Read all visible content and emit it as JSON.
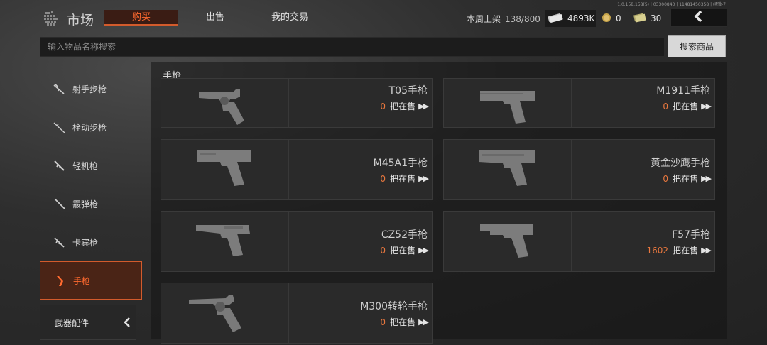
{
  "version": "1.0.158.158(5) | 03300843 | 11481450358 | 经验-7",
  "header": {
    "title": "市场",
    "tabs": [
      {
        "label": "购买",
        "active": true
      },
      {
        "label": "出售",
        "active": false
      },
      {
        "label": "我的交易",
        "active": false
      }
    ],
    "weekly_listing_label": "本周上架",
    "weekly_listing_value": "138/800",
    "currencies": [
      {
        "icon": "cash-stack-icon",
        "value": "4893K"
      },
      {
        "icon": "gold-coin-icon",
        "value": "0"
      },
      {
        "icon": "ticket-icon",
        "value": "30"
      }
    ]
  },
  "search": {
    "placeholder": "输入物品名称搜索",
    "button_label": "搜索商品"
  },
  "sidebar": {
    "items": [
      {
        "label": "射手步枪",
        "icon": "rifle-icon",
        "active": false
      },
      {
        "label": "栓动步枪",
        "icon": "sniper-rifle-icon",
        "active": false
      },
      {
        "label": "轻机枪",
        "icon": "machine-gun-icon",
        "active": false
      },
      {
        "label": "霰弹枪",
        "icon": "shotgun-icon",
        "active": false
      },
      {
        "label": "卡宾枪",
        "icon": "carbine-icon",
        "active": false
      },
      {
        "label": "手枪",
        "icon": "pistol-icon",
        "active": true
      }
    ],
    "accessories_label": "武器配件"
  },
  "main": {
    "section_title": "手枪",
    "on_sale_label": "把在售",
    "items": [
      {
        "name": "T05手枪",
        "count": "0",
        "image": "pistol-icon"
      },
      {
        "name": "M1911手枪",
        "count": "0",
        "image": "pistol-icon"
      },
      {
        "name": "M45A1手枪",
        "count": "0",
        "image": "pistol-icon"
      },
      {
        "name": "黄金沙鹰手枪",
        "count": "0",
        "image": "pistol-icon"
      },
      {
        "name": "CZ52手枪",
        "count": "0",
        "image": "pistol-icon"
      },
      {
        "name": "F57手枪",
        "count": "1602",
        "image": "pistol-icon"
      },
      {
        "name": "M300转轮手枪",
        "count": "0",
        "image": "revolver-icon"
      }
    ]
  },
  "colors": {
    "accent": "#ff6a2f",
    "accent_border": "#d35b2c",
    "count": "#e8773e"
  }
}
